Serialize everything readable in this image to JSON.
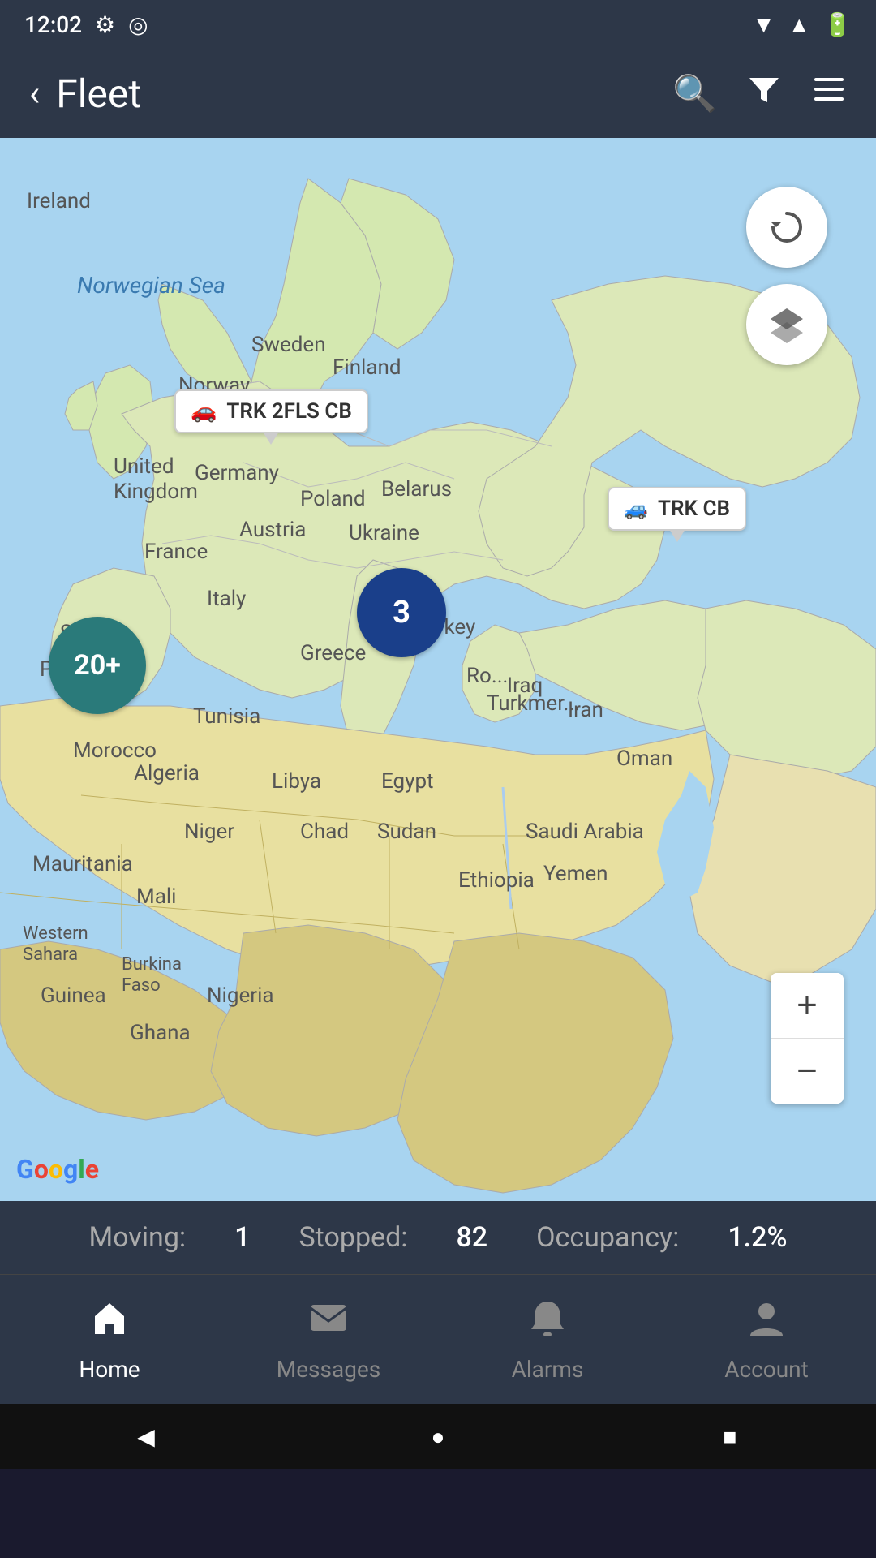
{
  "status_bar": {
    "time": "12:02",
    "settings_icon": "gear",
    "circle_icon": "circle-dot"
  },
  "nav_bar": {
    "back_icon": "back-arrow",
    "title": "Fleet",
    "search_icon": "search",
    "filter_icon": "filter",
    "menu_icon": "menu"
  },
  "map": {
    "refresh_icon": "refresh",
    "layers_icon": "layers",
    "zoom_in_label": "+",
    "zoom_out_label": "−",
    "marker_trk2flscb": "TRK 2FLS CB",
    "marker_trkcb": "TRK CB",
    "cluster_20plus": "20+",
    "cluster_3": "3",
    "google_logo": "Google"
  },
  "fleet_status": {
    "moving_label": "Moving:",
    "moving_value": "1",
    "stopped_label": "Stopped:",
    "stopped_value": "82",
    "occupancy_label": "Occupancy:",
    "occupancy_value": "1.2%"
  },
  "bottom_nav": {
    "home_label": "Home",
    "home_icon": "home",
    "messages_label": "Messages",
    "messages_icon": "mail",
    "alarms_label": "Alarms",
    "alarms_icon": "bell",
    "account_label": "Account",
    "account_icon": "person"
  },
  "android_nav": {
    "back_label": "◀",
    "home_label": "●",
    "recent_label": "■"
  }
}
